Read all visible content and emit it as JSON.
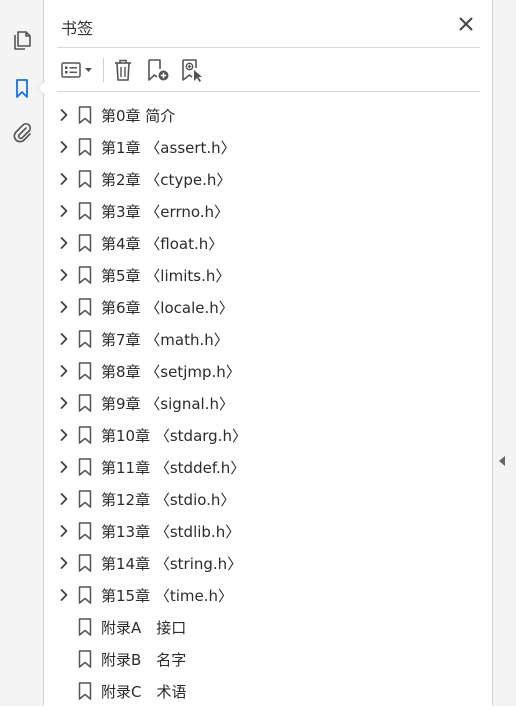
{
  "panel": {
    "title": "书签"
  },
  "colors": {
    "accent": "#1473e6",
    "icon": "#555555"
  },
  "sidebar": {
    "items": [
      {
        "name": "pages",
        "icon": "pages-icon"
      },
      {
        "name": "bookmarks",
        "icon": "bookmark-icon",
        "active": true
      },
      {
        "name": "attachments",
        "icon": "paperclip-icon"
      }
    ]
  },
  "toolbar": {
    "items": [
      "options-menu-icon",
      "delete-icon",
      "new-bookmark-icon",
      "new-bookmark-from-structure-icon"
    ]
  },
  "bookmarks": [
    {
      "label": "第0章 简介",
      "expandable": true
    },
    {
      "label": "第1章 〈assert.h〉",
      "expandable": true
    },
    {
      "label": "第2章 〈ctype.h〉",
      "expandable": true
    },
    {
      "label": "第3章 〈errno.h〉",
      "expandable": true
    },
    {
      "label": "第4章 〈float.h〉",
      "expandable": true
    },
    {
      "label": "第5章 〈limits.h〉",
      "expandable": true
    },
    {
      "label": "第6章 〈locale.h〉",
      "expandable": true
    },
    {
      "label": "第7章 〈math.h〉",
      "expandable": true
    },
    {
      "label": "第8章 〈setjmp.h〉",
      "expandable": true
    },
    {
      "label": "第9章 〈signal.h〉",
      "expandable": true
    },
    {
      "label": "第10章 〈stdarg.h〉",
      "expandable": true
    },
    {
      "label": "第11章 〈stddef.h〉",
      "expandable": true
    },
    {
      "label": "第12章 〈stdio.h〉",
      "expandable": true
    },
    {
      "label": "第13章 〈stdlib.h〉",
      "expandable": true
    },
    {
      "label": "第14章 〈string.h〉",
      "expandable": true
    },
    {
      "label": "第15章 〈time.h〉",
      "expandable": true
    },
    {
      "label": "附录A　接口",
      "expandable": false
    },
    {
      "label": "附录B　名字",
      "expandable": false
    },
    {
      "label": "附录C　术语",
      "expandable": false
    }
  ]
}
